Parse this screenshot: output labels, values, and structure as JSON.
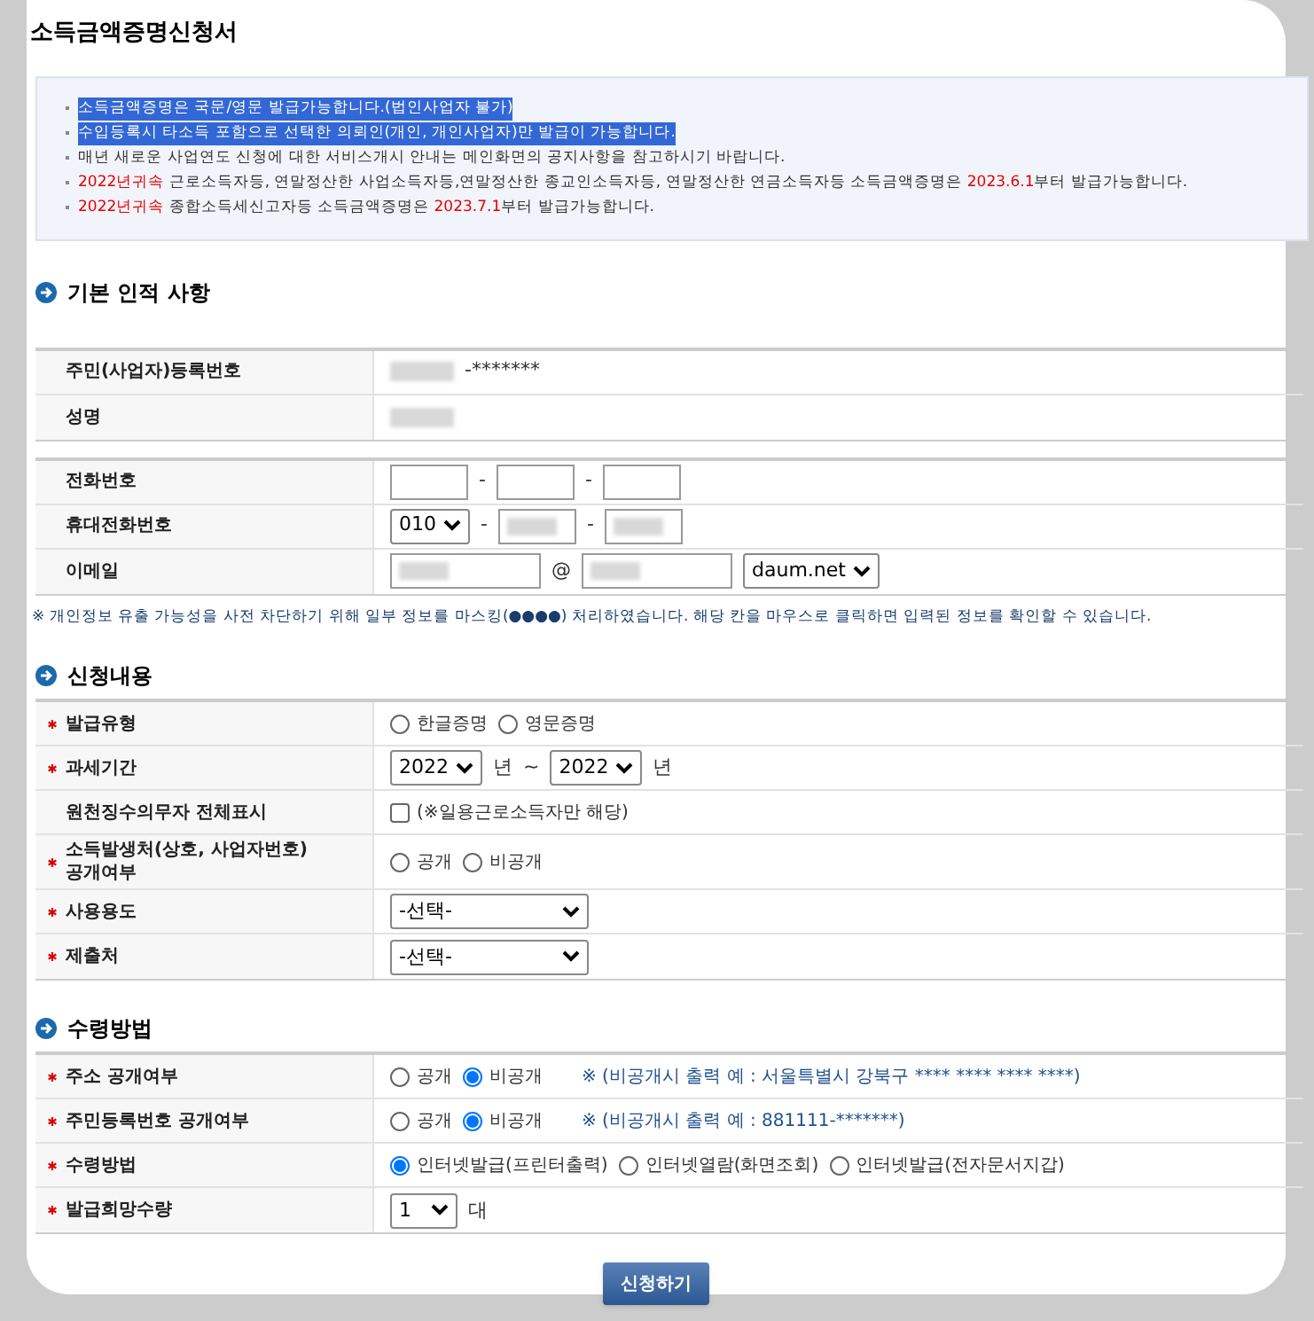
{
  "title": "소득금액증명신청서",
  "notices": [
    {
      "highlighted": true,
      "parts": [
        {
          "text": "소득금액증명은 국문/영문 발급가능합니다.(법인사업자 불가)",
          "red": false
        }
      ]
    },
    {
      "highlighted": true,
      "parts": [
        {
          "text": "수입등록시 타소득 포함으로 선택한 의뢰인(개인, 개인사업자)만 발급이 가능합니다.",
          "red": false
        }
      ]
    },
    {
      "highlighted": false,
      "parts": [
        {
          "text": "매년 새로운 사업연도 신청에 대한 서비스개시 안내는 메인화면의 공지사항을 참고하시기 바랍니다.",
          "red": false
        }
      ]
    },
    {
      "highlighted": false,
      "parts": [
        {
          "text": "2022년귀속",
          "red": true
        },
        {
          "text": " 근로소득자등, 연말정산한 사업소득자등,연말정산한 종교인소득자등, 연말정산한 연금소득자등 소득금액증명은 ",
          "red": false
        },
        {
          "text": "2023.6.1",
          "red": true
        },
        {
          "text": "부터 발급가능합니다.",
          "red": false
        }
      ]
    },
    {
      "highlighted": false,
      "parts": [
        {
          "text": "2022년귀속",
          "red": true
        },
        {
          "text": " 종합소득세신고자등 소득금액증명은 ",
          "red": false
        },
        {
          "text": "2023.7.1",
          "red": true
        },
        {
          "text": "부터 발급가능합니다.",
          "red": false
        }
      ]
    }
  ],
  "sections": [
    {
      "title": "기본 인적 사항",
      "tables": [
        {
          "rows": [
            {
              "label": "주민(사업자)등록번호",
              "required": false,
              "controls": [
                {
                  "kind": "masked"
                },
                {
                  "kind": "text",
                  "text": "-*******"
                }
              ]
            },
            {
              "label": "성명",
              "required": false,
              "controls": [
                {
                  "kind": "masked"
                }
              ]
            }
          ]
        },
        {
          "rows": [
            {
              "label": "전화번호",
              "required": false,
              "controls": [
                {
                  "kind": "input",
                  "masked": false
                },
                {
                  "kind": "text",
                  "text": "-"
                },
                {
                  "kind": "input",
                  "masked": false
                },
                {
                  "kind": "text",
                  "text": "-"
                },
                {
                  "kind": "input",
                  "masked": false
                }
              ]
            },
            {
              "label": "휴대전화번호",
              "required": false,
              "controls": [
                {
                  "kind": "select",
                  "value": "010"
                },
                {
                  "kind": "text",
                  "text": "-"
                },
                {
                  "kind": "input",
                  "masked": true
                },
                {
                  "kind": "text",
                  "text": "-"
                },
                {
                  "kind": "input",
                  "masked": true
                }
              ]
            },
            {
              "label": "이메일",
              "required": false,
              "controls": [
                {
                  "kind": "wide_input",
                  "masked": true
                },
                {
                  "kind": "text",
                  "text": "@"
                },
                {
                  "kind": "wide_input",
                  "masked": true
                },
                {
                  "kind": "select",
                  "value": "daum.net"
                }
              ]
            }
          ]
        }
      ],
      "footnote": "※ 개인정보 유출 가능성을 사전 차단하기 위해 일부 정보를 마스킹(●●●●) 처리하였습니다. 해당 칸을 마우스로 클릭하면 입력된 정보를 확인할 수 있습니다."
    },
    {
      "title": "신청내용",
      "tables": [
        {
          "rows": [
            {
              "label": "발급유형",
              "required": true,
              "controls": [
                {
                  "kind": "radio",
                  "label": "한글증명",
                  "selected": false
                },
                {
                  "kind": "radio",
                  "label": "영문증명",
                  "selected": false
                }
              ]
            },
            {
              "label": "과세기간",
              "required": true,
              "controls": [
                {
                  "kind": "select",
                  "value": "2022"
                },
                {
                  "kind": "text",
                  "text": "년"
                },
                {
                  "kind": "text",
                  "text": "~"
                },
                {
                  "kind": "select",
                  "value": "2022"
                },
                {
                  "kind": "text",
                  "text": "년"
                }
              ]
            },
            {
              "label": "원천징수의무자 전체표시",
              "required": false,
              "controls": [
                {
                  "kind": "checkbox",
                  "label": "(※일용근로소득자만 해당)",
                  "checked": false
                }
              ]
            },
            {
              "label": "소득발생처(상호, 사업자번호)\n공개여부",
              "required": true,
              "controls": [
                {
                  "kind": "radio",
                  "label": "공개",
                  "selected": false
                },
                {
                  "kind": "radio",
                  "label": "비공개",
                  "selected": false
                }
              ]
            },
            {
              "label": "사용용도",
              "required": true,
              "controls": [
                {
                  "kind": "wide_select",
                  "value": "-선택-"
                }
              ]
            },
            {
              "label": "제출처",
              "required": true,
              "controls": [
                {
                  "kind": "wide_select",
                  "value": "-선택-"
                }
              ]
            }
          ]
        }
      ]
    },
    {
      "title": "수령방법",
      "tables": [
        {
          "rows": [
            {
              "label": "주소 공개여부",
              "required": true,
              "controls": [
                {
                  "kind": "radio",
                  "label": "공개",
                  "selected": false
                },
                {
                  "kind": "radio",
                  "label": "비공개",
                  "selected": true
                },
                {
                  "kind": "note",
                  "text": "※ (비공개시 출력 예 : 서울특별시 강북구 **** **** **** ****)"
                }
              ]
            },
            {
              "label": "주민등록번호 공개여부",
              "required": true,
              "controls": [
                {
                  "kind": "radio",
                  "label": "공개",
                  "selected": false
                },
                {
                  "kind": "radio",
                  "label": "비공개",
                  "selected": true
                },
                {
                  "kind": "note",
                  "text": "※ (비공개시 출력 예 : 881111-*******)"
                }
              ]
            },
            {
              "label": "수령방법",
              "required": true,
              "controls": [
                {
                  "kind": "radio",
                  "label": "인터넷발급(프린터출력)",
                  "selected": true
                },
                {
                  "kind": "radio",
                  "label": "인터넷열람(화면조회)",
                  "selected": false
                },
                {
                  "kind": "radio",
                  "label": "인터넷발급(전자문서지갑)",
                  "selected": false
                }
              ]
            },
            {
              "label": "발급희망수량",
              "required": true,
              "controls": [
                {
                  "kind": "select",
                  "value": "1"
                },
                {
                  "kind": "text",
                  "text": "대"
                }
              ]
            }
          ]
        }
      ]
    }
  ],
  "submit": "신청하기"
}
